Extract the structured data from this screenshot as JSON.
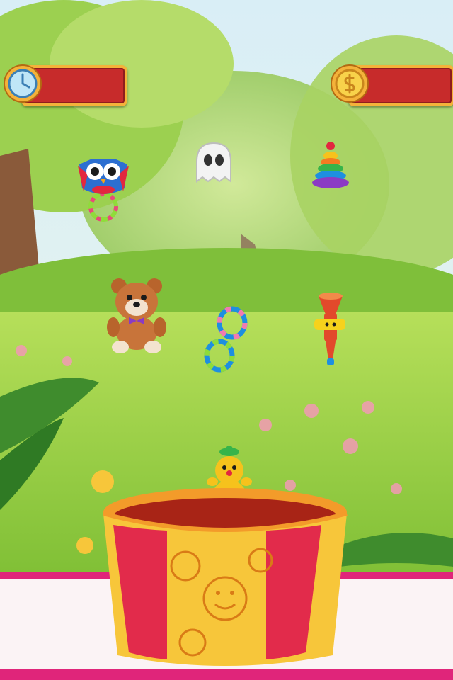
{
  "hud": {
    "timer": {
      "icon": "stopwatch-icon",
      "value": ""
    },
    "coins": {
      "icon": "coin-icon",
      "value": ""
    }
  },
  "toys": [
    {
      "id": "owl-rattle",
      "icon": "owl-rattle-icon"
    },
    {
      "id": "ghost",
      "icon": "ghost-icon"
    },
    {
      "id": "ring-stacker",
      "icon": "ring-stacker-icon"
    },
    {
      "id": "teddy-bear",
      "icon": "teddy-bear-icon"
    },
    {
      "id": "teether-ring",
      "icon": "teether-icon"
    },
    {
      "id": "toy-trumpet",
      "icon": "trumpet-icon"
    },
    {
      "id": "roly-poly",
      "icon": "roly-poly-icon"
    }
  ],
  "colors": {
    "sky": "#cfe8f4",
    "grass": "#9fd34a",
    "counter_trim": "#e0257a",
    "counter_fill": "#fbf3f5",
    "hud_panel": "#c72b2b",
    "hud_border": "#f4b23a",
    "basket_yellow": "#f7c63a",
    "basket_red": "#e22b4b"
  }
}
